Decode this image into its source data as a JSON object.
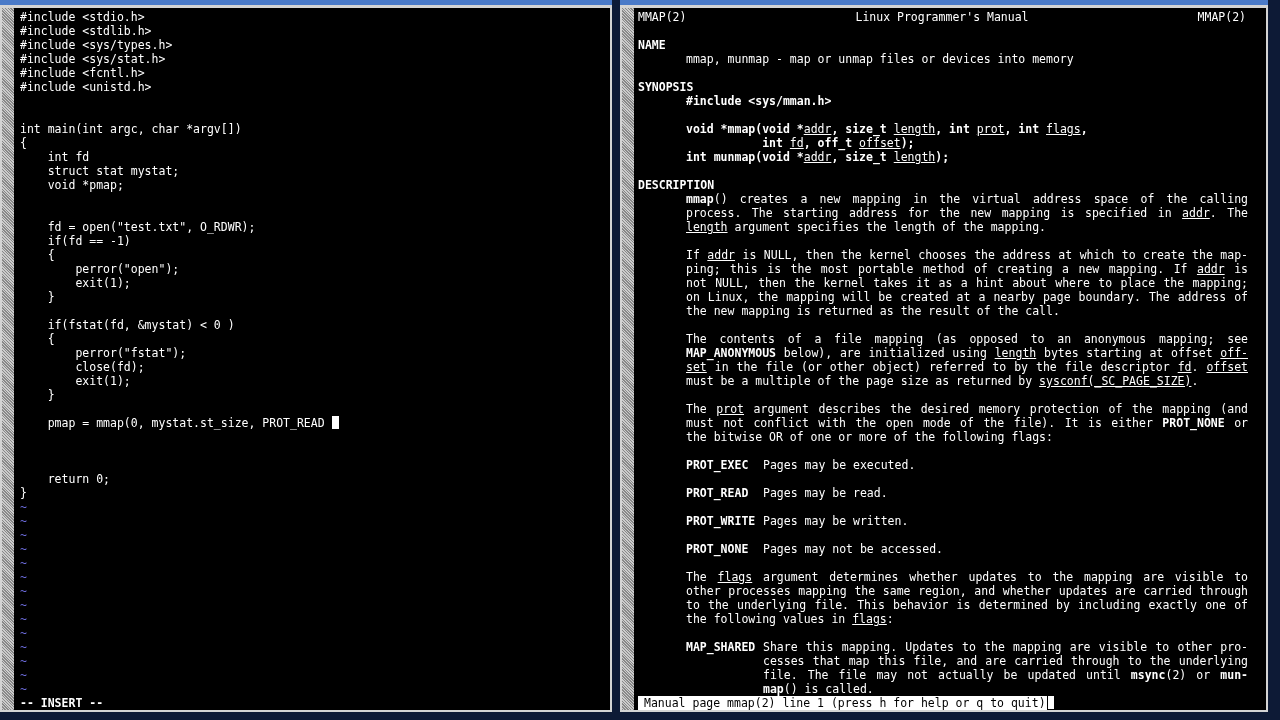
{
  "editor": {
    "lines": [
      {
        "kind": "code",
        "text": "#include <stdio.h>"
      },
      {
        "kind": "code",
        "text": "#include <stdlib.h>"
      },
      {
        "kind": "code",
        "text": "#include <sys/types.h>"
      },
      {
        "kind": "code",
        "text": "#include <sys/stat.h>"
      },
      {
        "kind": "code",
        "text": "#include <fcntl.h>"
      },
      {
        "kind": "code",
        "text": "#include <unistd.h>"
      },
      {
        "kind": "blank"
      },
      {
        "kind": "blank"
      },
      {
        "kind": "code",
        "text": "int main(int argc, char *argv[])"
      },
      {
        "kind": "code",
        "text": "{"
      },
      {
        "kind": "code",
        "text": "    int fd"
      },
      {
        "kind": "code",
        "text": "    struct stat mystat;"
      },
      {
        "kind": "code",
        "text": "    void *pmap;"
      },
      {
        "kind": "blank"
      },
      {
        "kind": "blank"
      },
      {
        "kind": "code",
        "text": "    fd = open(\"test.txt\", O_RDWR);"
      },
      {
        "kind": "code",
        "text": "    if(fd == -1)"
      },
      {
        "kind": "code",
        "text": "    {"
      },
      {
        "kind": "code",
        "text": "        perror(\"open\");"
      },
      {
        "kind": "code",
        "text": "        exit(1);"
      },
      {
        "kind": "code",
        "text": "    }"
      },
      {
        "kind": "blank"
      },
      {
        "kind": "code",
        "text": "    if(fstat(fd, &mystat) < 0 )"
      },
      {
        "kind": "code",
        "text": "    {"
      },
      {
        "kind": "code",
        "text": "        perror(\"fstat\");"
      },
      {
        "kind": "code",
        "text": "        close(fd);"
      },
      {
        "kind": "code",
        "text": "        exit(1);"
      },
      {
        "kind": "code",
        "text": "    }"
      },
      {
        "kind": "blank"
      },
      {
        "kind": "code",
        "text": "    pmap = mmap(0, mystat.st_size, PROT_READ ",
        "cursor": true
      },
      {
        "kind": "blank"
      },
      {
        "kind": "blank"
      },
      {
        "kind": "blank"
      },
      {
        "kind": "code",
        "text": "    return 0;"
      },
      {
        "kind": "code",
        "text": "}"
      },
      {
        "kind": "tilde",
        "text": "~"
      },
      {
        "kind": "tilde",
        "text": "~"
      },
      {
        "kind": "tilde",
        "text": "~"
      },
      {
        "kind": "tilde",
        "text": "~"
      },
      {
        "kind": "tilde",
        "text": "~"
      },
      {
        "kind": "tilde",
        "text": "~"
      },
      {
        "kind": "tilde",
        "text": "~"
      },
      {
        "kind": "tilde",
        "text": "~"
      },
      {
        "kind": "tilde",
        "text": "~"
      },
      {
        "kind": "tilde",
        "text": "~"
      },
      {
        "kind": "tilde",
        "text": "~"
      },
      {
        "kind": "tilde",
        "text": "~"
      },
      {
        "kind": "tilde",
        "text": "~"
      },
      {
        "kind": "tilde",
        "text": "~"
      }
    ],
    "mode": "-- INSERT --"
  },
  "manual": {
    "header": {
      "left": "MMAP(2)",
      "center": "Linux Programmer's Manual",
      "right": "MMAP(2)"
    },
    "lines": [
      {
        "kind": "blank"
      },
      {
        "kind": "heading",
        "text": "NAME"
      },
      {
        "kind": "body",
        "justified": false,
        "segments": [
          {
            "t": "mmap, munmap - map or unmap files or devices into memory"
          }
        ]
      },
      {
        "kind": "blank"
      },
      {
        "kind": "heading",
        "text": "SYNOPSIS"
      },
      {
        "kind": "body",
        "justified": false,
        "segments": [
          {
            "t": "#include <sys/mman.h>",
            "bold": true
          }
        ]
      },
      {
        "kind": "blank"
      },
      {
        "kind": "body",
        "justified": false,
        "segments": [
          {
            "t": "void *mmap(void *",
            "bold": true
          },
          {
            "t": "addr",
            "underline": true
          },
          {
            "t": ", size_t ",
            "bold": true
          },
          {
            "t": "length",
            "underline": true
          },
          {
            "t": ", int ",
            "bold": true
          },
          {
            "t": "prot",
            "underline": true
          },
          {
            "t": ", int ",
            "bold": true
          },
          {
            "t": "flags",
            "underline": true
          },
          {
            "t": ",",
            "bold": true
          }
        ]
      },
      {
        "kind": "body",
        "justified": false,
        "segments": [
          {
            "t": "           int ",
            "bold": true
          },
          {
            "t": "fd",
            "underline": true
          },
          {
            "t": ", off_t ",
            "bold": true
          },
          {
            "t": "offset",
            "underline": true
          },
          {
            "t": ");",
            "bold": true
          }
        ]
      },
      {
        "kind": "body",
        "justified": false,
        "segments": [
          {
            "t": "int munmap(void *",
            "bold": true
          },
          {
            "t": "addr",
            "underline": true
          },
          {
            "t": ", size_t ",
            "bold": true
          },
          {
            "t": "length",
            "underline": true
          },
          {
            "t": ");",
            "bold": true
          }
        ]
      },
      {
        "kind": "blank"
      },
      {
        "kind": "heading",
        "text": "DESCRIPTION"
      },
      {
        "kind": "body",
        "justified": true,
        "segments": [
          {
            "t": "mmap",
            "bold": true
          },
          {
            "t": "() creates a new mapping in the virtual address space of the calling"
          }
        ]
      },
      {
        "kind": "body",
        "justified": true,
        "segments": [
          {
            "t": "process. The starting address for the new mapping is specified in "
          },
          {
            "t": "addr",
            "underline": true
          },
          {
            "t": ". The"
          }
        ]
      },
      {
        "kind": "body",
        "justified": false,
        "segments": [
          {
            "t": "length",
            "underline": true
          },
          {
            "t": " argument specifies the length of the mapping."
          }
        ]
      },
      {
        "kind": "blank"
      },
      {
        "kind": "body",
        "justified": true,
        "segments": [
          {
            "t": "If "
          },
          {
            "t": "addr",
            "underline": true
          },
          {
            "t": " is NULL, then the kernel chooses the address at which to create the map-"
          }
        ]
      },
      {
        "kind": "body",
        "justified": true,
        "segments": [
          {
            "t": "ping; this is the most portable method of creating a new mapping. If "
          },
          {
            "t": "addr",
            "underline": true
          },
          {
            "t": " is"
          }
        ]
      },
      {
        "kind": "body",
        "justified": true,
        "segments": [
          {
            "t": "not NULL, then the kernel takes it as a hint about where to place the mapping;"
          }
        ]
      },
      {
        "kind": "body",
        "justified": true,
        "segments": [
          {
            "t": "on Linux, the mapping will be created at a nearby page boundary. The address of"
          }
        ]
      },
      {
        "kind": "body",
        "justified": false,
        "segments": [
          {
            "t": "the new mapping is returned as the result of the call."
          }
        ]
      },
      {
        "kind": "blank"
      },
      {
        "kind": "body",
        "justified": true,
        "segments": [
          {
            "t": "The contents of a file mapping (as opposed to an anonymous mapping; see"
          }
        ]
      },
      {
        "kind": "body",
        "justified": true,
        "segments": [
          {
            "t": "MAP_ANONYMOUS",
            "bold": true
          },
          {
            "t": " below), are initialized using "
          },
          {
            "t": "length",
            "underline": true
          },
          {
            "t": " bytes starting at offset "
          },
          {
            "t": "off-",
            "underline": true
          }
        ]
      },
      {
        "kind": "body",
        "justified": true,
        "segments": [
          {
            "t": "set",
            "underline": true
          },
          {
            "t": " in the file (or other object) referred to by the file descriptor "
          },
          {
            "t": "fd",
            "underline": true
          },
          {
            "t": ". "
          },
          {
            "t": "offset",
            "underline": true
          }
        ]
      },
      {
        "kind": "body",
        "justified": false,
        "segments": [
          {
            "t": "must be a multiple of the page size as returned by "
          },
          {
            "t": "sysconf(_SC_PAGE_SIZE)",
            "underline": true
          },
          {
            "t": "."
          }
        ]
      },
      {
        "kind": "blank"
      },
      {
        "kind": "body",
        "justified": true,
        "segments": [
          {
            "t": "The "
          },
          {
            "t": "prot",
            "underline": true
          },
          {
            "t": " argument describes the desired memory protection of the mapping (and"
          }
        ]
      },
      {
        "kind": "body",
        "justified": true,
        "segments": [
          {
            "t": "must not conflict with the open mode of the file). It is either "
          },
          {
            "t": "PROT_NONE",
            "bold": true
          },
          {
            "t": " or"
          }
        ]
      },
      {
        "kind": "body",
        "justified": false,
        "segments": [
          {
            "t": "the bitwise OR of one or more of the following flags:"
          }
        ]
      },
      {
        "kind": "blank"
      },
      {
        "kind": "item",
        "tag": "PROT_EXEC",
        "text": "Pages may be executed."
      },
      {
        "kind": "blank"
      },
      {
        "kind": "item",
        "tag": "PROT_READ",
        "text": "Pages may be read."
      },
      {
        "kind": "blank"
      },
      {
        "kind": "item",
        "tag": "PROT_WRITE",
        "text": "Pages may be written."
      },
      {
        "kind": "blank"
      },
      {
        "kind": "item",
        "tag": "PROT_NONE",
        "text": "Pages may not be accessed."
      },
      {
        "kind": "blank"
      },
      {
        "kind": "body",
        "justified": true,
        "segments": [
          {
            "t": "The "
          },
          {
            "t": "flags",
            "underline": true
          },
          {
            "t": " argument determines whether updates to the mapping are visible to"
          }
        ]
      },
      {
        "kind": "body",
        "justified": true,
        "segments": [
          {
            "t": "other processes mapping the same region, and whether updates are carried through"
          }
        ]
      },
      {
        "kind": "body",
        "justified": true,
        "segments": [
          {
            "t": "to the underlying file. This behavior is determined by including exactly one of"
          }
        ]
      },
      {
        "kind": "body",
        "justified": false,
        "segments": [
          {
            "t": "the following values in "
          },
          {
            "t": "flags",
            "underline": true
          },
          {
            "t": ":"
          }
        ]
      },
      {
        "kind": "blank"
      },
      {
        "kind": "item",
        "tag": "MAP_SHARED",
        "text": "Share this mapping. Updates to the mapping are visible to other pro-",
        "justified": true
      },
      {
        "kind": "cont",
        "justified": true,
        "segments": [
          {
            "t": "cesses that map this file, and are carried through to the underlying"
          }
        ]
      },
      {
        "kind": "cont",
        "justified": true,
        "segments": [
          {
            "t": "file. The file may not actually be updated until "
          },
          {
            "t": "msync",
            "bold": true
          },
          {
            "t": "(2) or "
          },
          {
            "t": "mun-",
            "bold": true
          }
        ]
      },
      {
        "kind": "cont",
        "justified": false,
        "segments": [
          {
            "t": "map",
            "bold": true
          },
          {
            "t": "() is called."
          }
        ]
      }
    ],
    "status": {
      "text": "Manual page mmap(2) line 1 (press h for help or q to quit)",
      "cursor": true
    }
  }
}
